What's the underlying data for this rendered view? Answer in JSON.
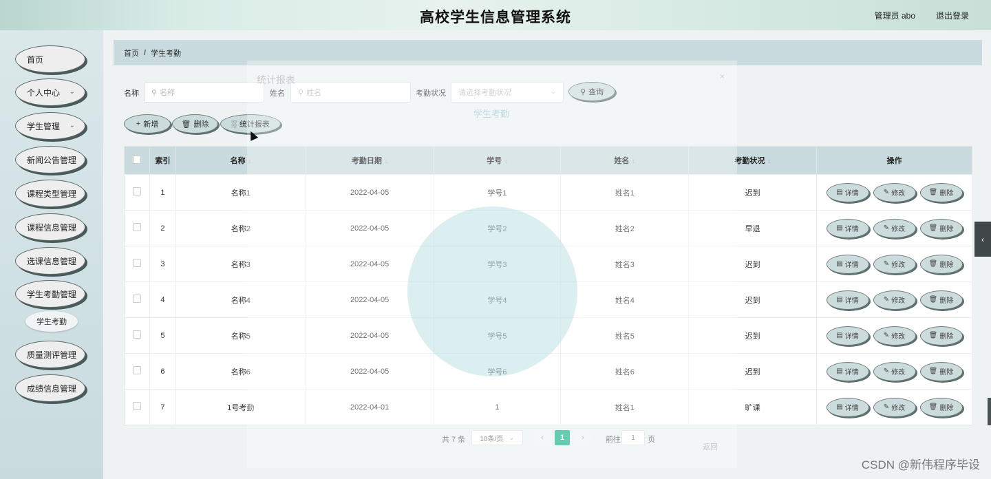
{
  "header": {
    "title": "高校学生信息管理系统",
    "user": "管理员 abo",
    "logout": "退出登录"
  },
  "sidebar": {
    "items": [
      {
        "label": "首页",
        "has_arrow": false
      },
      {
        "label": "个人中心",
        "has_arrow": true
      },
      {
        "label": "学生管理",
        "has_arrow": true
      },
      {
        "label": "新闻公告管理",
        "has_arrow": false
      },
      {
        "label": "课程类型管理",
        "has_arrow": false
      },
      {
        "label": "课程信息管理",
        "has_arrow": false
      },
      {
        "label": "选课信息管理",
        "has_arrow": false
      },
      {
        "label": "学生考勤管理",
        "has_arrow": false
      },
      {
        "label": "质量测评管理",
        "has_arrow": false
      },
      {
        "label": "成绩信息管理",
        "has_arrow": false
      }
    ],
    "sub_item": "学生考勤"
  },
  "breadcrumb": {
    "home": "首页",
    "separator": "/",
    "current": "学生考勤"
  },
  "search": {
    "name_label": "名称",
    "name_placeholder": "名称",
    "person_label": "姓名",
    "person_placeholder": "姓名",
    "status_label": "考勤状况",
    "status_placeholder": "请选择考勤状况",
    "query_button": "查询"
  },
  "actions": {
    "add": "新增",
    "delete": "删除",
    "report": "统计报表"
  },
  "table": {
    "headers": [
      "索引",
      "名称",
      "考勤日期",
      "学号",
      "姓名",
      "考勤状况",
      "操作"
    ],
    "rows": [
      {
        "index": "1",
        "name": "名称1",
        "date": "2022-04-05",
        "student_no": "学号1",
        "person": "姓名1",
        "status": "迟到"
      },
      {
        "index": "2",
        "name": "名称2",
        "date": "2022-04-05",
        "student_no": "学号2",
        "person": "姓名2",
        "status": "早退"
      },
      {
        "index": "3",
        "name": "名称3",
        "date": "2022-04-05",
        "student_no": "学号3",
        "person": "姓名3",
        "status": "迟到"
      },
      {
        "index": "4",
        "name": "名称4",
        "date": "2022-04-05",
        "student_no": "学号4",
        "person": "姓名4",
        "status": "迟到"
      },
      {
        "index": "5",
        "name": "名称5",
        "date": "2022-04-05",
        "student_no": "学号5",
        "person": "姓名5",
        "status": "迟到"
      },
      {
        "index": "6",
        "name": "名称6",
        "date": "2022-04-05",
        "student_no": "学号6",
        "person": "姓名6",
        "status": "迟到"
      },
      {
        "index": "7",
        "name": "1号考勤",
        "date": "2022-04-01",
        "student_no": "1",
        "person": "姓名1",
        "status": "旷课"
      }
    ],
    "row_actions": {
      "detail": "详情",
      "edit": "修改",
      "delete": "删除"
    }
  },
  "pagination": {
    "total": "共 7 条",
    "page_size": "10条/页",
    "current_page": "1",
    "goto_label": "前往",
    "goto_value": "1",
    "page_suffix": "页"
  },
  "overlay": {
    "title": "统计报表",
    "subtitle": "学生考勤",
    "close": "×",
    "return": "返回"
  },
  "watermark": "CSDN @新伟程序毕设",
  "colors": {
    "accent": "#1eb48c",
    "header_bg": "#d8ece6",
    "table_header": "#c9dbde"
  }
}
